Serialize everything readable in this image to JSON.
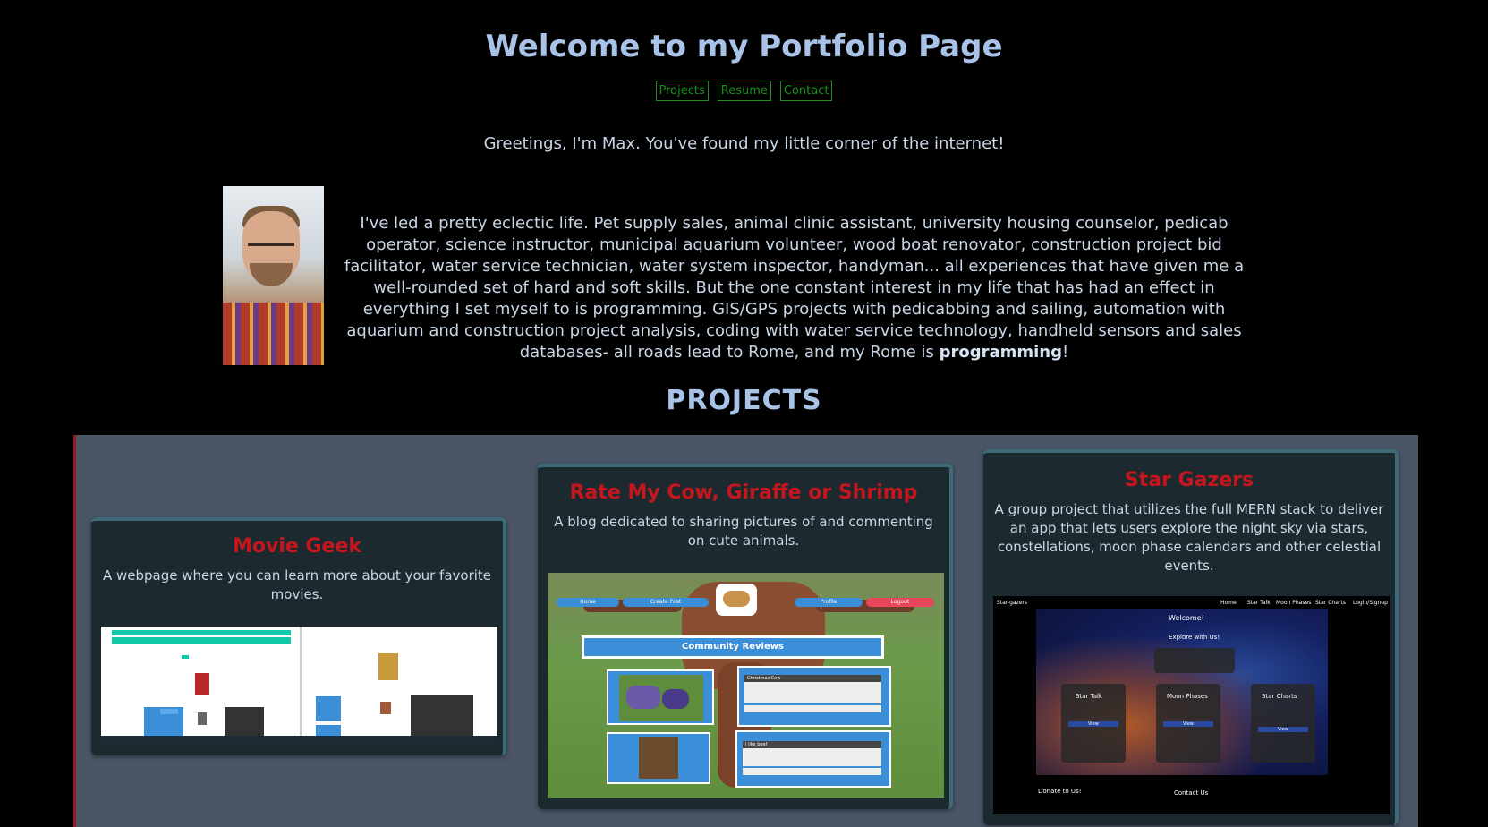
{
  "header": {
    "title": "Welcome to my Portfolio Page",
    "nav": [
      "Projects",
      "Resume",
      "Contact"
    ]
  },
  "intro": {
    "greeting": "Greetings, I'm Max. You've found my little corner of the internet!",
    "bio_text": "I've led a pretty eclectic life. Pet supply sales, animal clinic assistant, university housing counselor, pedicab operator, science instructor, municipal aquarium volunteer, wood boat renovator, construction project bid facilitator, water service technician, water system inspector, handyman... all experiences that have given me a well-rounded set of hard and soft skills. But the one constant interest in my life that has had an effect in everything I set myself to is programming. GIS/GPS projects with pedicabbing and sailing, automation with aquarium and construction project analysis, coding with water service technology, handheld sensors and sales databases- all roads lead to Rome, and my Rome is",
    "bio_emphasis": "programming",
    "bio_end": "!"
  },
  "projects": {
    "heading": "PROJECTS",
    "cards": [
      {
        "title": "Movie Geek",
        "description": "A webpage where you can learn more about your favorite movies."
      },
      {
        "title": "Rate My Cow, Giraffe or Shrimp",
        "description": "A blog dedicated to sharing pictures of and commenting on cute animals.",
        "screenshot": {
          "nav": [
            "Home",
            "Create Post",
            "Profile",
            "Logout"
          ],
          "reviews_header": "Community Reviews",
          "posts": [
            "Christmas Cow",
            "I like beef"
          ]
        }
      },
      {
        "title": "Star Gazers",
        "description": "A group project that utilizes the full MERN stack to deliver an app that lets users explore the night sky via stars, constellations, moon phase calendars and other celestial events.",
        "screenshot": {
          "brand": "Star-gazers",
          "nav": [
            "Home",
            "Star Talk",
            "Moon Phases",
            "Star Charts",
            "Login/Signup"
          ],
          "welcome": "Welcome!",
          "explore": "Explore with Us!",
          "panels": [
            "Star Talk",
            "Moon Phases",
            "Star Charts"
          ],
          "button": "View",
          "footer_left": "Donate to Us!",
          "footer_center": "Contact Us"
        }
      }
    ]
  },
  "colors": {
    "title": "#a9c3e8",
    "nav": "#1c8f1c",
    "card_title": "#c4161c",
    "projects_bg": "#4a5566",
    "card_bg": "#1c2a30"
  }
}
